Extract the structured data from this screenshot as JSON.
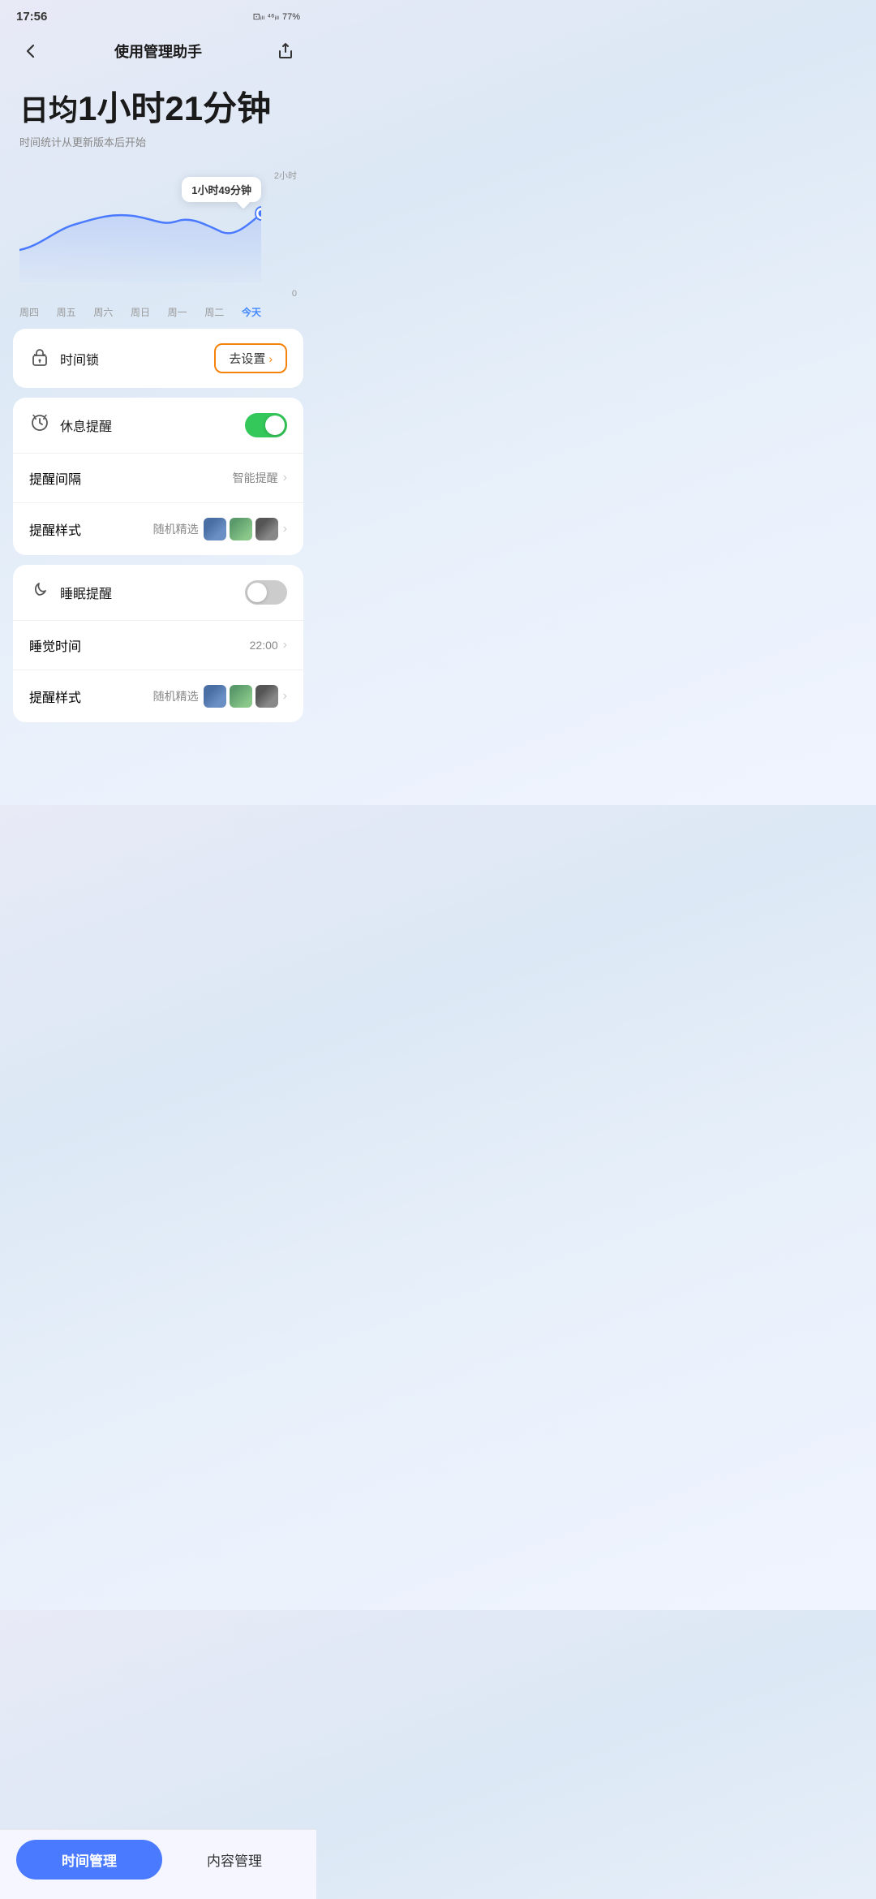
{
  "statusBar": {
    "time": "17:56",
    "battery": "77%",
    "icons": "⊡ 4G 4G"
  },
  "header": {
    "title": "使用管理助手",
    "backIcon": "‹",
    "shareIcon": "↗"
  },
  "dailyAverage": {
    "label": "日均",
    "hours": "1小时",
    "minutes": "21分钟",
    "subtitle": "时间统计从更新版本后开始"
  },
  "chart": {
    "tooltip": "1小时49分钟",
    "yLabels": [
      "2小时",
      "0"
    ],
    "xLabels": [
      "周四",
      "周五",
      "周六",
      "周日",
      "周一",
      "周二",
      "今天"
    ]
  },
  "timeLock": {
    "icon": "🔒",
    "label": "时间锁",
    "btnLabel": "去设置",
    "btnChevron": "›"
  },
  "restReminder": {
    "icon": "⏱",
    "label": "休息提醒",
    "toggleOn": true
  },
  "reminderInterval": {
    "label": "提醒间隔",
    "value": "智能提醒",
    "chevron": "›"
  },
  "reminderStyle": {
    "label": "提醒样式",
    "value": "随机精选",
    "chevron": "›"
  },
  "sleepReminder": {
    "icon": "🌙",
    "label": "睡眠提醒",
    "toggleOn": false
  },
  "sleepTime": {
    "label": "睡觉时间",
    "value": "22:00",
    "chevron": "›"
  },
  "sleepReminderStyle": {
    "label": "提醒样式",
    "value": "随机精选",
    "chevron": "›"
  },
  "bottomNav": {
    "activeLabel": "时间管理",
    "inactiveLabel": "内容管理"
  }
}
